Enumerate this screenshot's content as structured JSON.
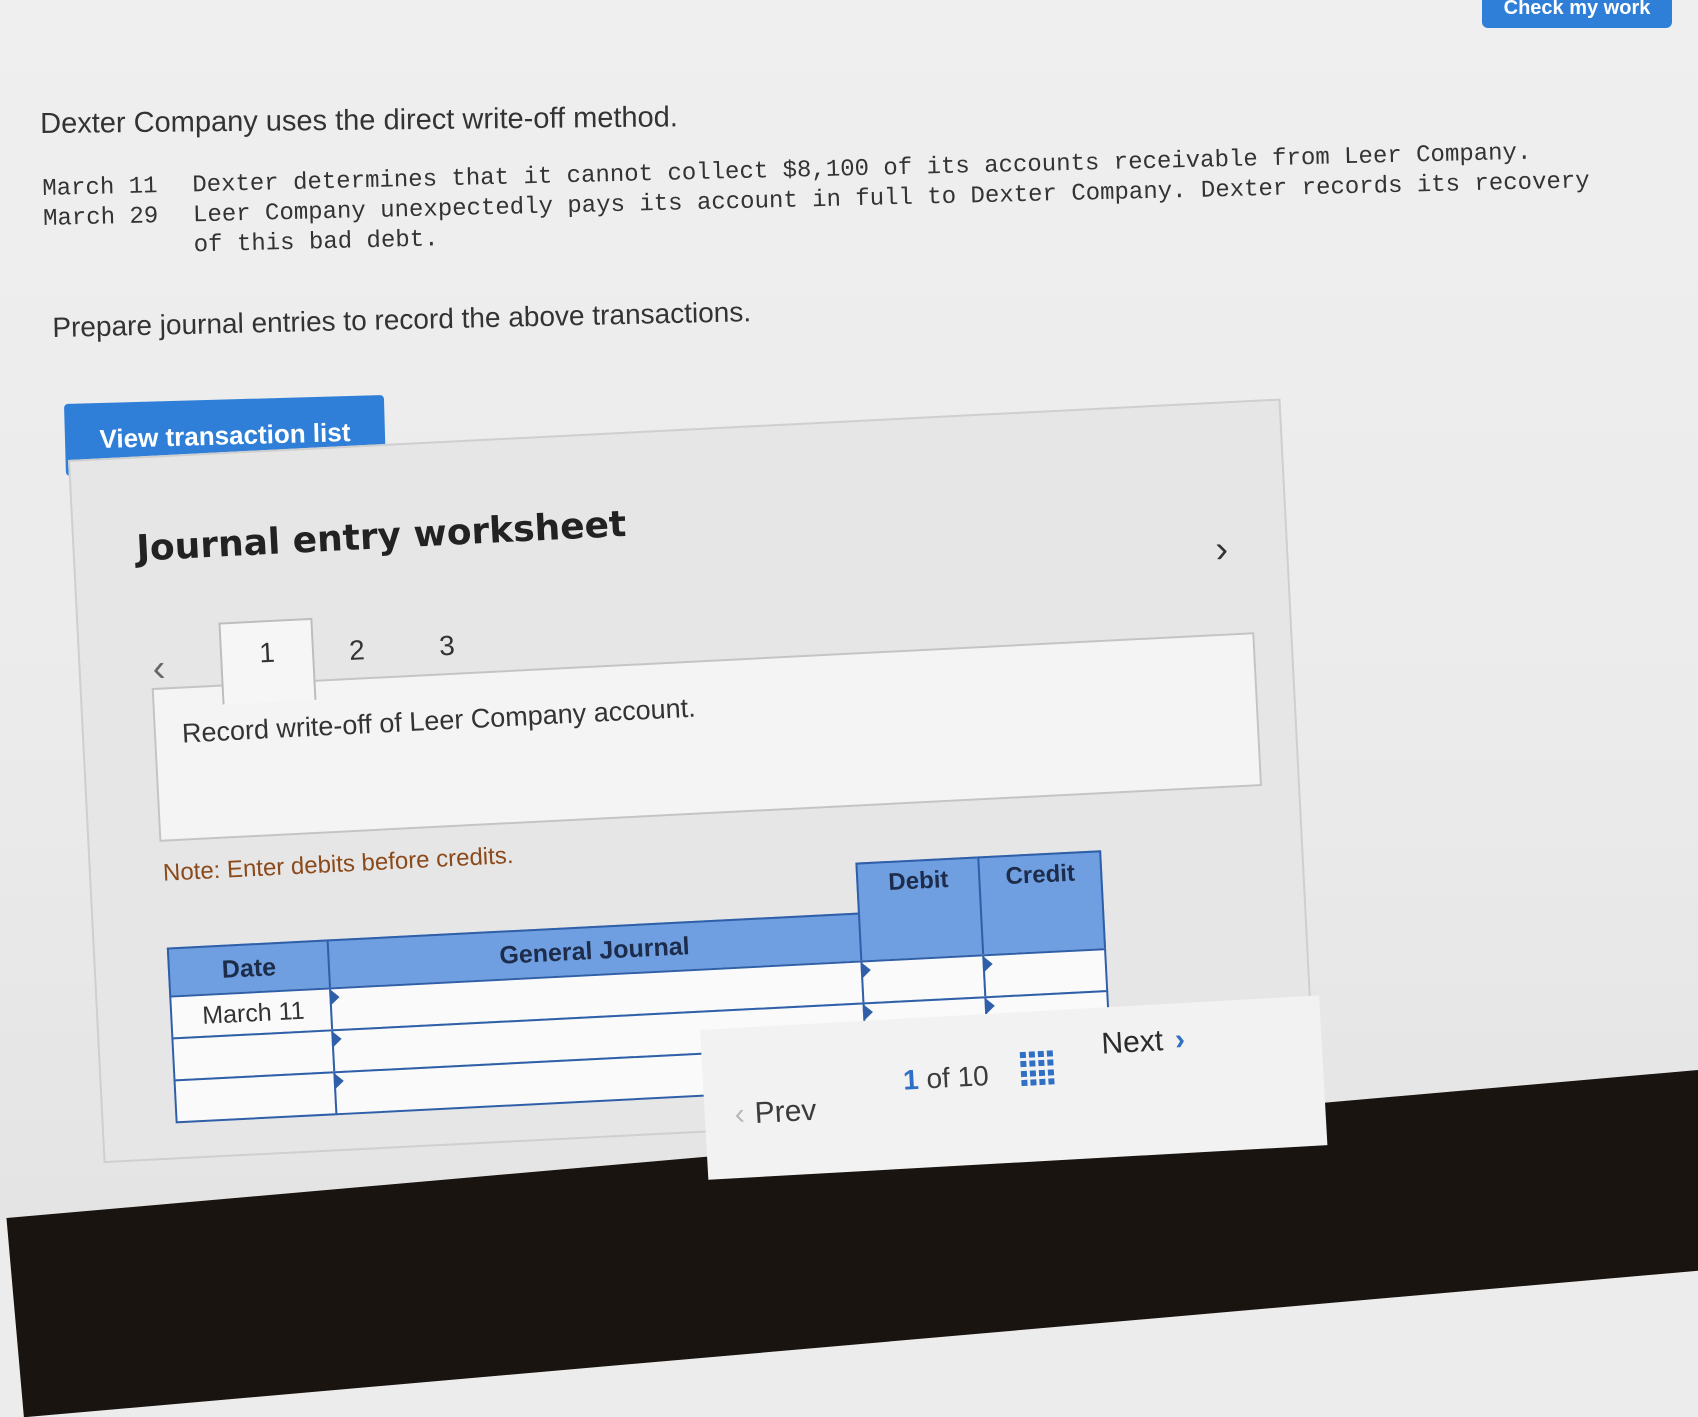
{
  "header": {
    "check_label": "Check my work"
  },
  "problem": {
    "intro": "Dexter Company uses the direct write-off method.",
    "transactions": [
      {
        "date": "March 11",
        "text": "Dexter determines that it cannot collect $8,100 of its accounts receivable from Leer Company."
      },
      {
        "date": "March 29",
        "text": "Leer Company unexpectedly pays its account in full to Dexter Company. Dexter records its recovery of this bad debt."
      }
    ],
    "instruction": "Prepare journal entries to record the above transactions."
  },
  "view_list_label": "View transaction list",
  "worksheet": {
    "title": "Journal entry worksheet",
    "tabs": [
      "1",
      "2",
      "3"
    ],
    "active_tab": "1",
    "description": "Record write-off of Leer Company account.",
    "note": "Note: Enter debits before credits.",
    "columns": {
      "date": "Date",
      "general_journal": "General Journal",
      "debit": "Debit",
      "credit": "Credit"
    },
    "rows": [
      {
        "date": "March 11",
        "account": "",
        "debit": "",
        "credit": ""
      },
      {
        "date": "",
        "account": "",
        "debit": "",
        "credit": ""
      },
      {
        "date": "",
        "account": "",
        "debit": "",
        "credit": ""
      }
    ]
  },
  "pagination": {
    "prev_label": "Prev",
    "current": "1",
    "of_label": "of",
    "total": "10",
    "next_label": "Next"
  }
}
